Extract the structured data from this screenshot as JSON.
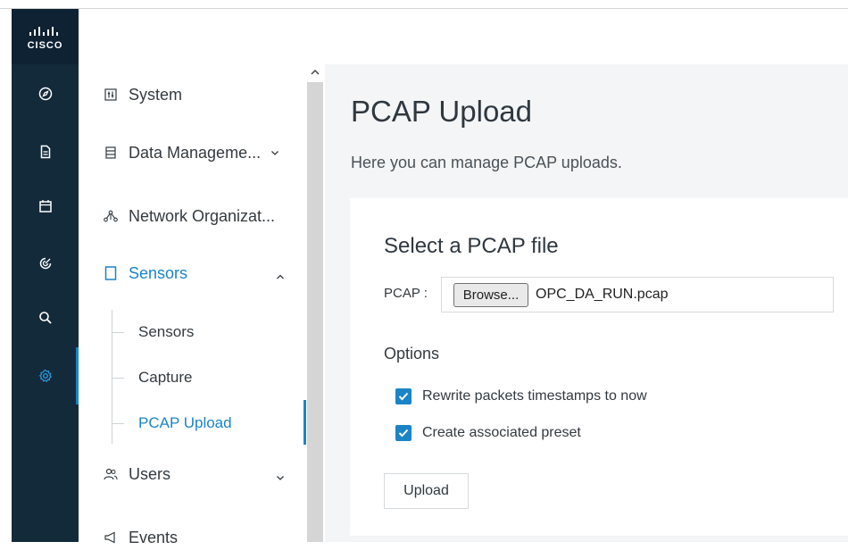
{
  "brand": {
    "logo_text": "CISCO"
  },
  "rail": {
    "icons": [
      {
        "name": "compass-icon"
      },
      {
        "name": "document-icon"
      },
      {
        "name": "calendar-icon"
      },
      {
        "name": "target-icon"
      },
      {
        "name": "search-icon"
      },
      {
        "name": "gear-icon",
        "active": true
      }
    ]
  },
  "nav": {
    "items": [
      {
        "label": "System"
      },
      {
        "label": "Data Manageme..."
      },
      {
        "label": "Network Organizat..."
      },
      {
        "label": "Sensors",
        "active": true
      },
      {
        "label": "Users"
      },
      {
        "label": "Events"
      }
    ],
    "sub_items": [
      {
        "label": "Sensors"
      },
      {
        "label": "Capture"
      },
      {
        "label": "PCAP Upload",
        "active": true
      }
    ]
  },
  "page": {
    "title": "PCAP Upload",
    "description": "Here you can manage PCAP uploads."
  },
  "form": {
    "card_title": "Select a PCAP file",
    "pcap_label": "PCAP :",
    "browse_label": "Browse...",
    "file_name": "OPC_DA_RUN.pcap",
    "options_label": "Options",
    "options": [
      {
        "label": "Rewrite packets timestamps to now",
        "checked": true
      },
      {
        "label": "Create associated preset",
        "checked": true
      }
    ],
    "upload_label": "Upload"
  },
  "colors": {
    "accent": "#1a84c7",
    "rail": "#132a3b",
    "content_bg": "#f4f5f6"
  }
}
